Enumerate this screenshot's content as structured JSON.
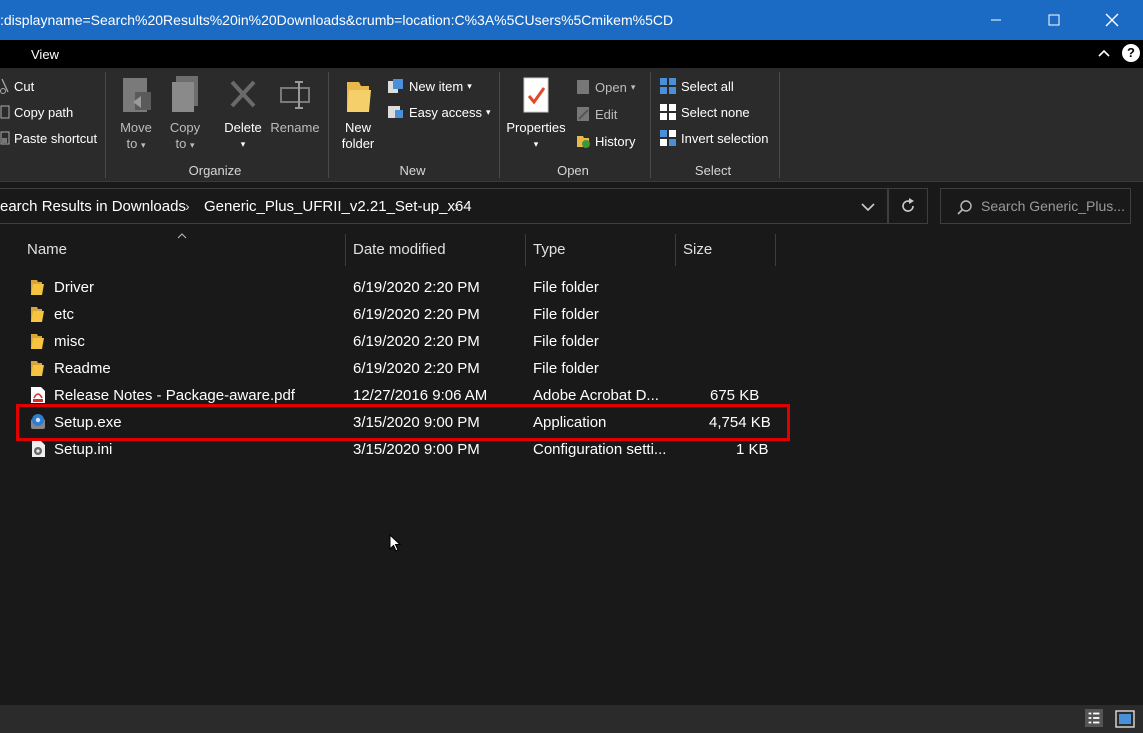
{
  "window": {
    "title": ":displayname=Search%20Results%20in%20Downloads&crumb=location:C%3A%5CUsers%5Cmikem%5CD"
  },
  "ribbon_tabs": {
    "view": "View"
  },
  "ribbon": {
    "clipboard": {
      "cut": "Cut",
      "copy_path": "Copy path",
      "paste_shortcut": "Paste shortcut"
    },
    "organize": {
      "move_to_l1": "Move",
      "move_to_l2": "to",
      "copy_to_l1": "Copy",
      "copy_to_l2": "to",
      "delete": "Delete",
      "rename": "Rename",
      "label": "Organize"
    },
    "new": {
      "new_folder_l1": "New",
      "new_folder_l2": "folder",
      "new_item": "New item",
      "easy_access": "Easy access",
      "label": "New"
    },
    "open": {
      "properties": "Properties",
      "open": "Open",
      "edit": "Edit",
      "history": "History",
      "label": "Open"
    },
    "select": {
      "select_all": "Select all",
      "select_none": "Select none",
      "invert_selection": "Invert selection",
      "label": "Select"
    }
  },
  "address": {
    "crumbs": [
      "earch Results in Downloads",
      "Generic_Plus_UFRII_v2.21_Set-up_x64"
    ],
    "search_placeholder": "Search Generic_Plus..."
  },
  "columns": {
    "name": "Name",
    "date": "Date modified",
    "type": "Type",
    "size": "Size"
  },
  "files": [
    {
      "name": "Driver",
      "date": "6/19/2020 2:20 PM",
      "type": "File folder",
      "size": "",
      "icon": "folder-icon"
    },
    {
      "name": "etc",
      "date": "6/19/2020 2:20 PM",
      "type": "File folder",
      "size": "",
      "icon": "folder-icon"
    },
    {
      "name": "misc",
      "date": "6/19/2020 2:20 PM",
      "type": "File folder",
      "size": "",
      "icon": "folder-icon"
    },
    {
      "name": "Readme",
      "date": "6/19/2020 2:20 PM",
      "type": "File folder",
      "size": "",
      "icon": "folder-icon"
    },
    {
      "name": "Release Notes - Package-aware.pdf",
      "date": "12/27/2016 9:06 AM",
      "type": "Adobe Acrobat D...",
      "size": "675 KB",
      "icon": "pdf-icon"
    },
    {
      "name": "Setup.exe",
      "date": "3/15/2020 9:00 PM",
      "type": "Application",
      "size": "4,754 KB",
      "icon": "setup-exe-icon"
    },
    {
      "name": "Setup.ini",
      "date": "3/15/2020 9:00 PM",
      "type": "Configuration setti...",
      "size": "1 KB",
      "icon": "config-file-icon"
    }
  ],
  "colors": {
    "titlebar": "#1b6bc4",
    "highlight": "#e00000",
    "folder": "#f5c542"
  }
}
